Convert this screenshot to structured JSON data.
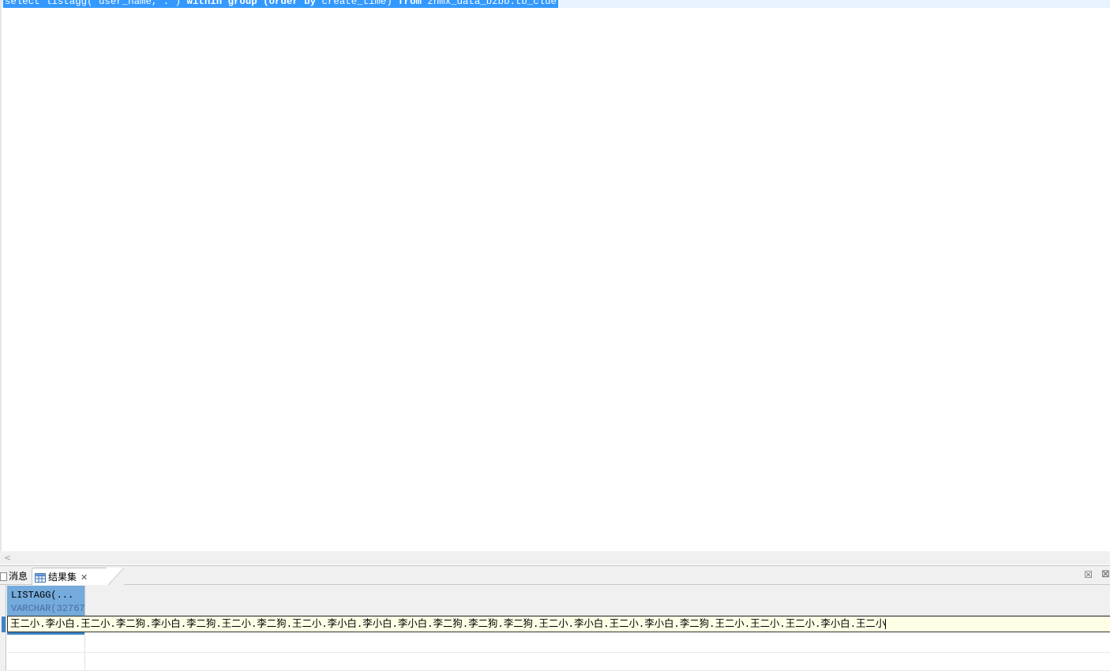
{
  "editor": {
    "sql_text": "select listagg( user_name,'.') within group (order by create_time) from zhmx_data_bzbb.tb_clue",
    "sql_tokens": [
      {
        "text": "select",
        "keyword": false
      },
      {
        "text": " listagg( user_name,'.') ",
        "keyword": false
      },
      {
        "text": "within group",
        "keyword": true
      },
      {
        "text": " ",
        "keyword": false
      },
      {
        "text": "(order by",
        "keyword": true
      },
      {
        "text": " create_time) ",
        "keyword": false
      },
      {
        "text": "from",
        "keyword": true
      },
      {
        "text": " zhmx_data_bzbb.tb_clue",
        "keyword": false
      }
    ]
  },
  "scrollbar": {
    "left_arrow": "<"
  },
  "panel": {
    "tabs": [
      {
        "label": "消息",
        "icon": "message-icon",
        "active": false
      },
      {
        "label": "结果集",
        "icon": "grid-icon",
        "active": true
      }
    ],
    "close_icon": "close-icon",
    "close_all_icon": "close-all-icon"
  },
  "grid": {
    "columns": [
      {
        "name": "LISTAGG(...",
        "type": "VARCHAR(32767)"
      }
    ],
    "rows": [
      [
        "王二小.李小白.王二小.李二狗.李小白.李二狗.王二小.李二狗.王二小.李小白.李小白.李小白.李二狗.李二狗.李二狗.王二小.李小白.王二小.李小白.李二狗.王二小.王二小.王二小.李小白.王二小"
      ]
    ]
  },
  "colors": {
    "selection": "#3399ff",
    "header_selected": "#74aadc",
    "cell_edit_bg": "#ffffe6"
  }
}
